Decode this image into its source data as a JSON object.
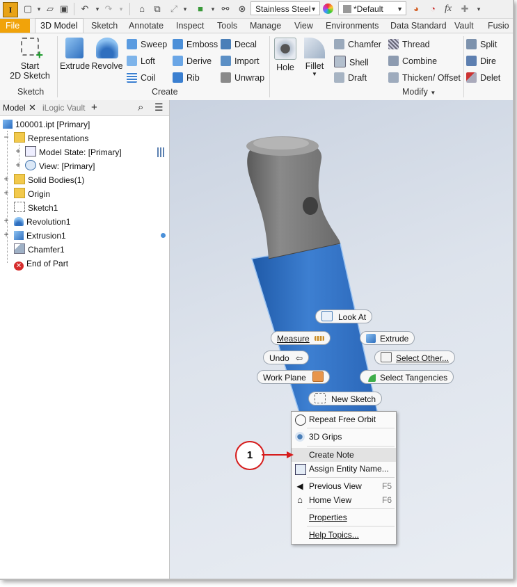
{
  "qat": {
    "app_letter": "I",
    "material": "Stainless Steel",
    "appearance": "*Default",
    "fx": "fx"
  },
  "tabs": [
    "File",
    "3D Model",
    "Sketch",
    "Annotate",
    "Inspect",
    "Tools",
    "Manage",
    "View",
    "Environments",
    "Data Standard",
    "Vault",
    "Fusio"
  ],
  "ribbon": {
    "sketch": {
      "start_line1": "Start",
      "start_line2": "2D Sketch",
      "panel": "Sketch"
    },
    "create": {
      "extrude": "Extrude",
      "revolve": "Revolve",
      "sweep": "Sweep",
      "loft": "Loft",
      "coil": "Coil",
      "emboss": "Emboss",
      "derive": "Derive",
      "rib": "Rib",
      "decal": "Decal",
      "import": "Import",
      "unwrap": "Unwrap",
      "panel": "Create"
    },
    "modify": {
      "hole": "Hole",
      "fillet": "Fillet",
      "chamfer": "Chamfer",
      "shell": "Shell",
      "draft": "Draft",
      "thread": "Thread",
      "combine": "Combine",
      "thicken": "Thicken/ Offset",
      "split": "Split",
      "direct": "Dire",
      "delete": "Delet",
      "panel": "Modify"
    }
  },
  "browser": {
    "tabs": [
      "Model",
      "iLogic",
      "Vault"
    ],
    "tree": [
      "100001.ipt [Primary]",
      "Representations",
      "Model State: [Primary]",
      "View: [Primary]",
      "Solid Bodies(1)",
      "Origin",
      "Sketch1",
      "Revolution1",
      "Extrusion1",
      "Chamfer1",
      "End of Part"
    ]
  },
  "marking_menu": {
    "look_at": "Look At",
    "measure": "Measure",
    "extrude": "Extrude",
    "undo": "Undo",
    "select_other": "Select Other...",
    "work_plane": "Work Plane",
    "select_tangencies": "Select Tangencies",
    "new_sketch": "New Sketch"
  },
  "context_menu": {
    "items": [
      {
        "label": "Repeat Free Orbit",
        "key": ""
      },
      {
        "label": "3D Grips",
        "key": ""
      },
      {
        "label": "Create Note",
        "key": ""
      },
      {
        "label": "Assign Entity Name...",
        "key": ""
      },
      {
        "label": "Previous View",
        "key": "F5"
      },
      {
        "label": "Home View",
        "key": "F6"
      },
      {
        "label": "Properties",
        "key": ""
      },
      {
        "label": "Help Topics...",
        "key": ""
      }
    ],
    "highlighted": "Create Note"
  },
  "callout": {
    "number": "1"
  },
  "colors": {
    "file_tab": "#f1a30a",
    "model_blue": "#3d7fd1",
    "handle_gray": "#7a7a7a",
    "callout_red": "#d61c1c"
  }
}
